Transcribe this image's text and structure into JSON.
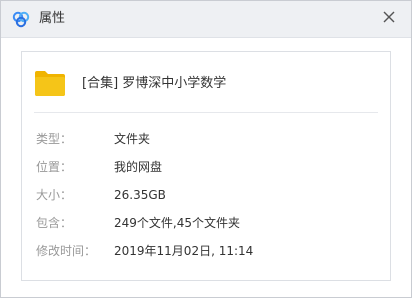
{
  "window": {
    "title": "属性"
  },
  "item": {
    "name": "[合集] 罗博深中小学数学"
  },
  "properties": [
    {
      "label": "类型：",
      "value": "文件夹"
    },
    {
      "label": "位置：",
      "value": "我的网盘"
    },
    {
      "label": "大小：",
      "value": "26.35GB"
    },
    {
      "label": "包含：",
      "value": "249个文件,45个文件夹"
    },
    {
      "label": "修改时间：",
      "value": "2019年11月02日, 11:14"
    }
  ],
  "icons": {
    "app": "baidu-netdisk-logo-icon",
    "close": "close-icon",
    "folder": "folder-icon"
  },
  "colors": {
    "titlebar_bg": "#eef0f3",
    "folder_yellow": "#f5c518",
    "label_gray": "#999999",
    "text_dark": "#333333"
  }
}
